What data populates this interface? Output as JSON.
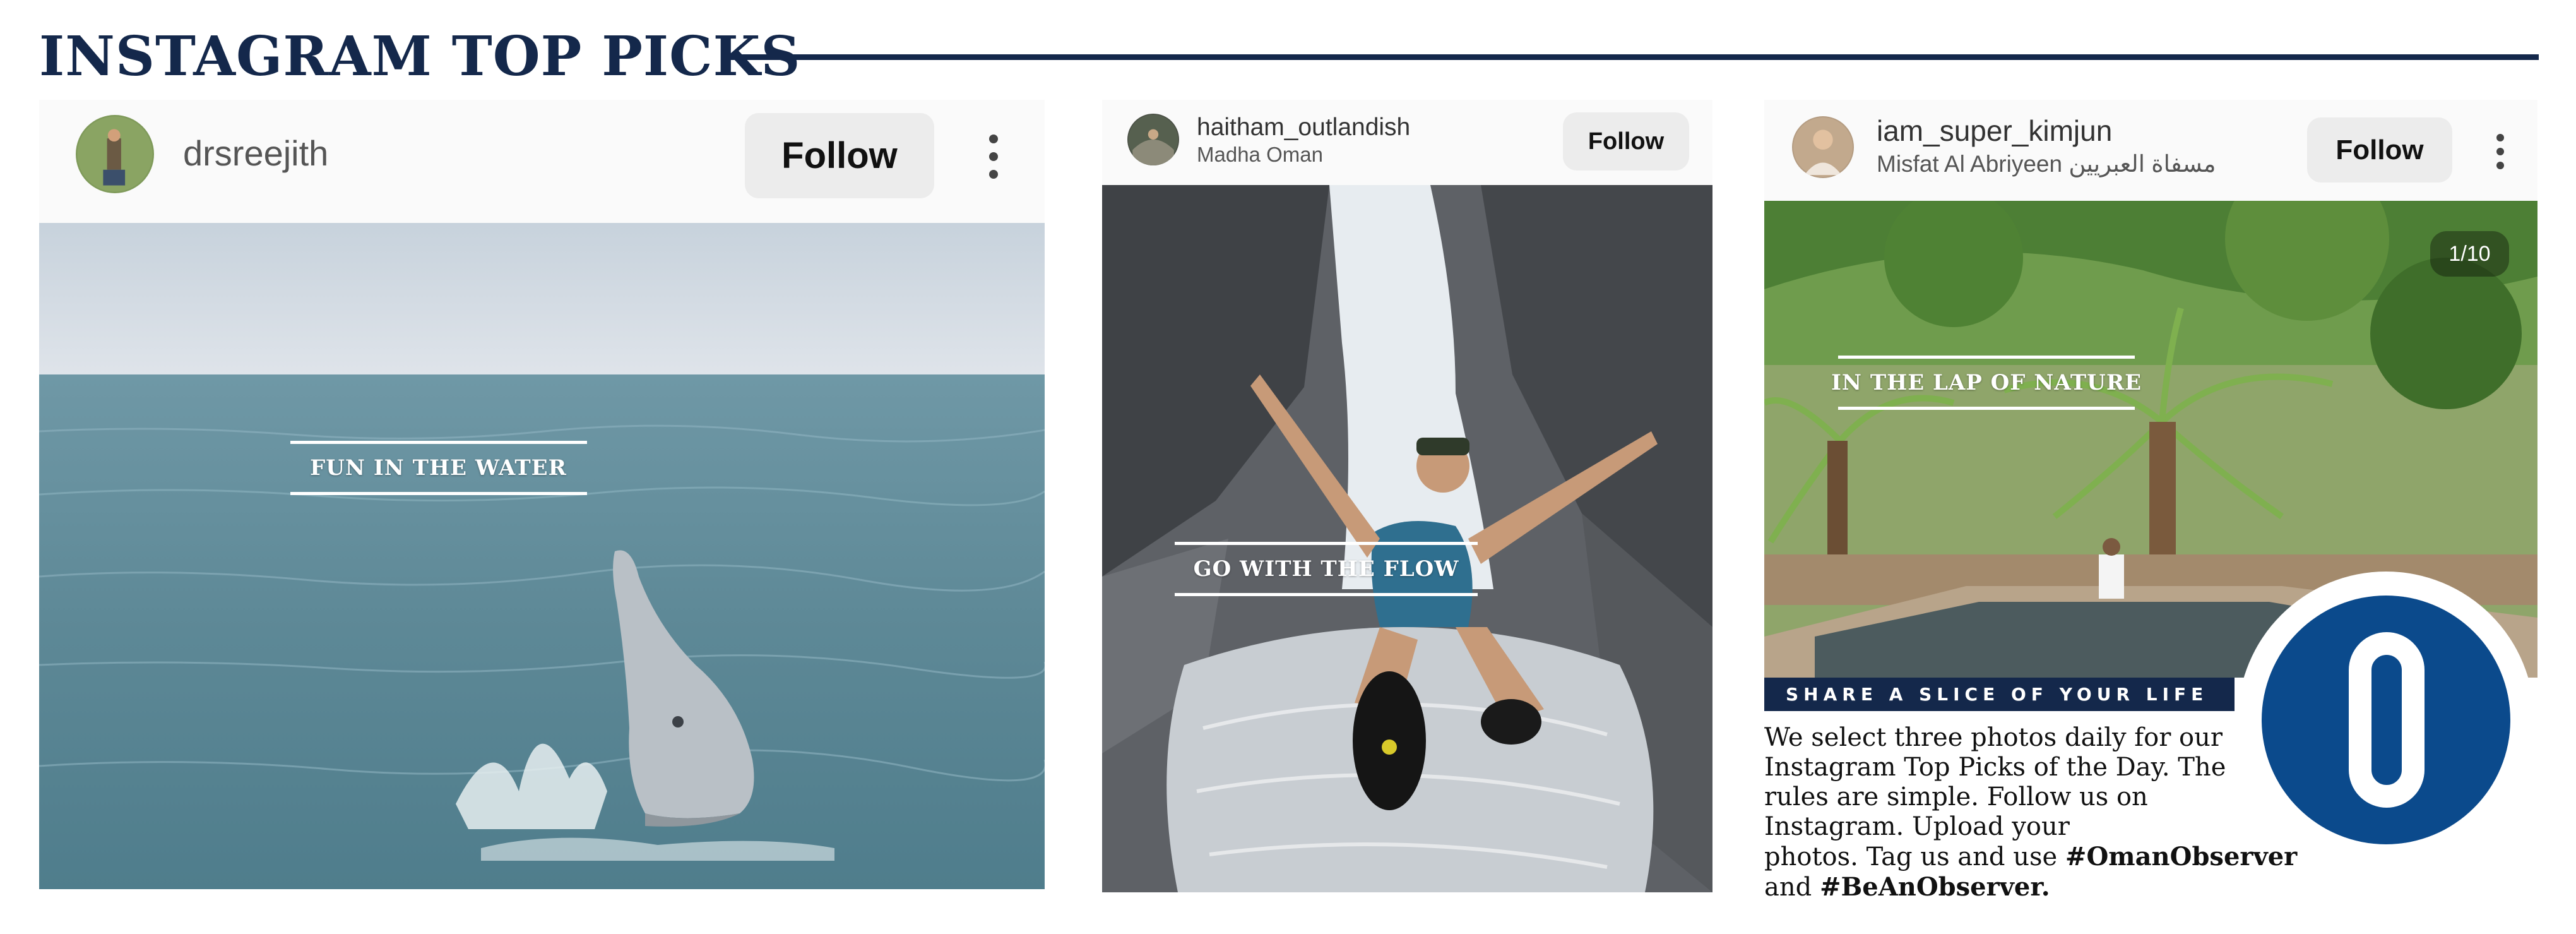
{
  "page": {
    "title": "INSTAGRAM TOP PICKS"
  },
  "cards": [
    {
      "username": "drsreejith",
      "location": "",
      "follow_label": "Follow",
      "overlay_caption": "FUN IN THE WATER",
      "more_icon": "more-vertical-icon"
    },
    {
      "username": "haitham_outlandish",
      "location": "Madha Oman",
      "follow_label": "Follow",
      "overlay_caption": "GO WITH THE FLOW"
    },
    {
      "username": "iam_super_kimjun",
      "location": "Misfat Al Abriyeen  مسفاة العبريين",
      "follow_label": "Follow",
      "overlay_caption": "IN THE LAP OF NATURE",
      "photo_counter": "1/10",
      "more_icon": "more-vertical-icon"
    }
  ],
  "info": {
    "banner": "SHARE A SLICE OF YOUR LIFE",
    "body_lines": [
      "We select three photos daily for our",
      "Instagram Top Picks of the Day. The",
      "rules are simple. Follow us on",
      "Instagram. Upload your"
    ],
    "line5_text": "photos. Tag us and use ",
    "hashtag1": "#OmanObserver",
    "line6_text": "and ",
    "hashtag2": "#BeAnObserver."
  },
  "logo": {
    "name": "oman-observer-logo",
    "color": "#0b4a8c"
  },
  "colors": {
    "navy": "#14284b",
    "brand_blue": "#0b4a8c"
  }
}
